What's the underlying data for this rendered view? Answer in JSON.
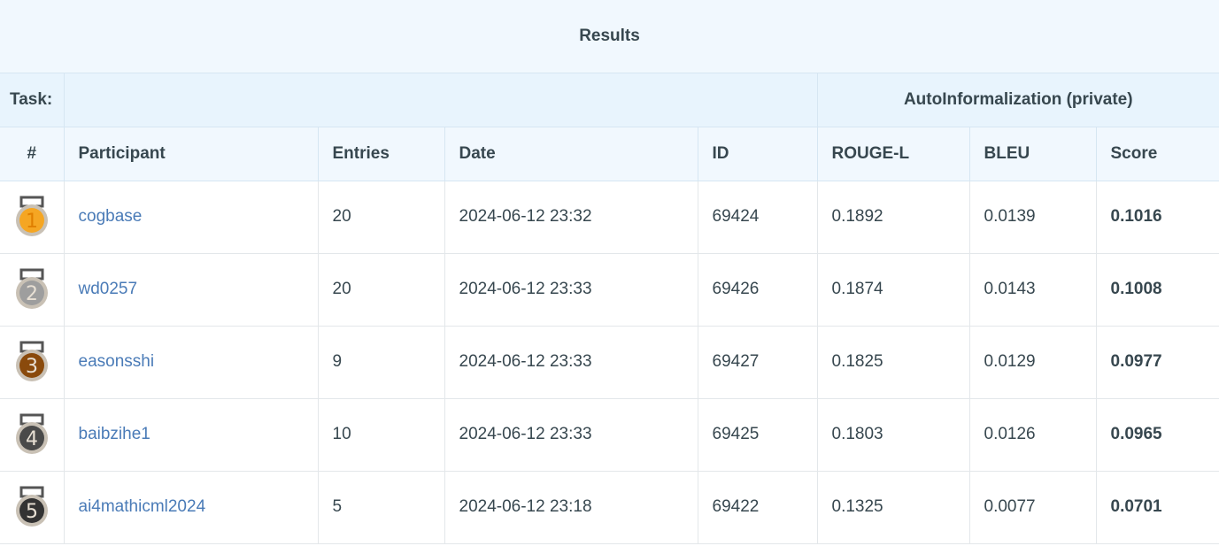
{
  "title": "Results",
  "task": {
    "label": "Task:",
    "name": "AutoInformalization (private)"
  },
  "columns": {
    "rank": "#",
    "participant": "Participant",
    "entries": "Entries",
    "date": "Date",
    "id": "ID",
    "rouge": "ROUGE-L",
    "bleu": "BLEU",
    "score": "Score"
  },
  "rows": [
    {
      "rank": "1",
      "medal_color": "#f5a623",
      "participant": "cogbase",
      "entries": "20",
      "date": "2024-06-12 23:32",
      "id": "69424",
      "rouge": "0.1892",
      "bleu": "0.0139",
      "score": "0.1016"
    },
    {
      "rank": "2",
      "medal_color": "#9e9e9e",
      "participant": "wd0257",
      "entries": "20",
      "date": "2024-06-12 23:33",
      "id": "69426",
      "rouge": "0.1874",
      "bleu": "0.0143",
      "score": "0.1008"
    },
    {
      "rank": "3",
      "medal_color": "#8a4a0c",
      "participant": "easonsshi",
      "entries": "9",
      "date": "2024-06-12 23:33",
      "id": "69427",
      "rouge": "0.1825",
      "bleu": "0.0129",
      "score": "0.0977"
    },
    {
      "rank": "4",
      "medal_color": "#4a4a4a",
      "participant": "baibzihe1",
      "entries": "10",
      "date": "2024-06-12 23:33",
      "id": "69425",
      "rouge": "0.1803",
      "bleu": "0.0126",
      "score": "0.0965"
    },
    {
      "rank": "5",
      "medal_color": "#333333",
      "participant": "ai4mathicml2024",
      "entries": "5",
      "date": "2024-06-12 23:18",
      "id": "69422",
      "rouge": "0.1325",
      "bleu": "0.0077",
      "score": "0.0701"
    }
  ]
}
